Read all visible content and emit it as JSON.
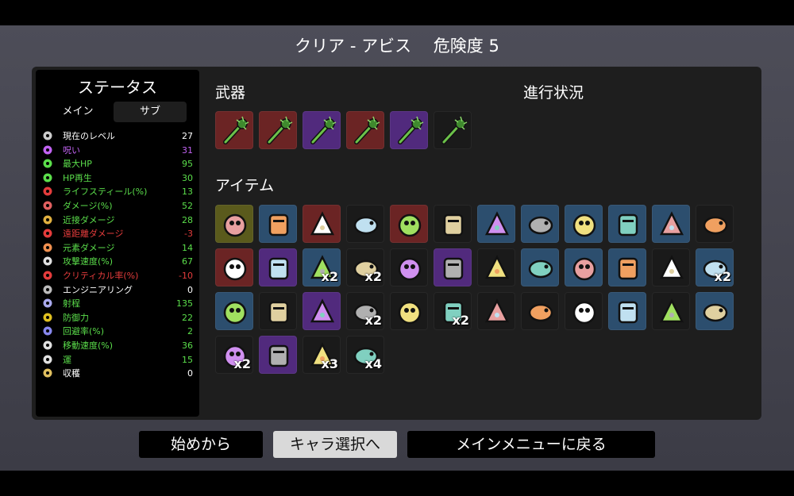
{
  "header": {
    "title": "クリア - アビス　 危険度 5"
  },
  "colors": {
    "white": "#ffffff",
    "purple": "#c163f2",
    "green": "#5bde4b",
    "red": "#e43c3c",
    "slot_red": "#6b2424",
    "slot_purple": "#512a7d",
    "slot_blue": "#2c4e6e",
    "slot_gray": "#1a1a1a",
    "slot_olive": "#5a5a1c"
  },
  "stats": {
    "title": "ステータス",
    "tabs": [
      "メイン",
      "サブ"
    ],
    "rows": [
      {
        "icon": "level-icon",
        "label": "現在のレベル",
        "value": "27",
        "color": "#ffffff"
      },
      {
        "icon": "curse-icon",
        "label": "呪い",
        "value": "31",
        "color": "#c163f2"
      },
      {
        "icon": "heart-icon",
        "label": "最大HP",
        "value": "95",
        "color": "#5bde4b"
      },
      {
        "icon": "hp-regen-icon",
        "label": "HP再生",
        "value": "30",
        "color": "#5bde4b"
      },
      {
        "icon": "lifesteal-icon",
        "label": "ライフスティール(%)",
        "value": "13",
        "color": "#5bde4b"
      },
      {
        "icon": "damage-icon",
        "label": "ダメージ(%)",
        "value": "52",
        "color": "#5bde4b"
      },
      {
        "icon": "melee-icon",
        "label": "近接ダメージ",
        "value": "28",
        "color": "#5bde4b"
      },
      {
        "icon": "ranged-icon",
        "label": "遠距離ダメージ",
        "value": "-3",
        "color": "#e43c3c"
      },
      {
        "icon": "elemental-icon",
        "label": "元素ダメージ",
        "value": "14",
        "color": "#5bde4b"
      },
      {
        "icon": "attack-speed-icon",
        "label": "攻撃速度(%)",
        "value": "67",
        "color": "#5bde4b"
      },
      {
        "icon": "crit-icon",
        "label": "クリティカル率(%)",
        "value": "-10",
        "color": "#e43c3c"
      },
      {
        "icon": "engineering-icon",
        "label": "エンジニアリング",
        "value": "0",
        "color": "#ffffff"
      },
      {
        "icon": "range-icon",
        "label": "射程",
        "value": "135",
        "color": "#5bde4b"
      },
      {
        "icon": "armor-icon",
        "label": "防御力",
        "value": "22",
        "color": "#5bde4b"
      },
      {
        "icon": "dodge-icon",
        "label": "回避率(%)",
        "value": "2",
        "color": "#5bde4b"
      },
      {
        "icon": "speed-icon",
        "label": "移動速度(%)",
        "value": "36",
        "color": "#5bde4b"
      },
      {
        "icon": "luck-icon",
        "label": "運",
        "value": "15",
        "color": "#5bde4b"
      },
      {
        "icon": "harvest-icon",
        "label": "収穫",
        "value": "0",
        "color": "#ffffff"
      }
    ]
  },
  "weapons": {
    "title": "武器",
    "slots": [
      {
        "icon": "thorn-club-icon",
        "tier": "red"
      },
      {
        "icon": "thorn-club-icon",
        "tier": "red"
      },
      {
        "icon": "thorn-club-icon",
        "tier": "purple"
      },
      {
        "icon": "thorn-club-icon",
        "tier": "red"
      },
      {
        "icon": "thorn-club-icon",
        "tier": "purple"
      },
      {
        "icon": "thorn-club-icon",
        "tier": "gray"
      }
    ]
  },
  "progress": {
    "title": "進行状況"
  },
  "items": {
    "title": "アイテム",
    "rows": [
      [
        {
          "icon": "ninja-mask-icon",
          "tier": "olive",
          "qty": ""
        },
        {
          "icon": "scroll-icon",
          "tier": "blue",
          "qty": ""
        },
        {
          "icon": "panda-icon",
          "tier": "red",
          "qty": ""
        },
        {
          "icon": "lemonade-icon",
          "tier": "gray",
          "qty": ""
        },
        {
          "icon": "octopus-icon",
          "tier": "red",
          "qty": ""
        },
        {
          "icon": "shark-tooth-icon",
          "tier": "gray",
          "qty": ""
        },
        {
          "icon": "crab-claws-icon",
          "tier": "blue",
          "qty": ""
        },
        {
          "icon": "pirate-bandana-icon",
          "tier": "blue",
          "qty": ""
        },
        {
          "icon": "black-belt-icon",
          "tier": "blue",
          "qty": ""
        },
        {
          "icon": "garden-icon",
          "tier": "blue",
          "qty": ""
        },
        {
          "icon": "crystal-ball-icon",
          "tier": "blue",
          "qty": ""
        },
        {
          "icon": "penguin-icon",
          "tier": "gray",
          "qty": ""
        }
      ],
      [
        {
          "icon": "stomach-icon",
          "tier": "red",
          "qty": ""
        },
        {
          "icon": "pumpkin-icon",
          "tier": "purple",
          "qty": ""
        },
        {
          "icon": "spyglass-icon",
          "tier": "blue",
          "qty": "x2"
        },
        {
          "icon": "demon-mask-icon",
          "tier": "gray",
          "qty": "x2"
        },
        {
          "icon": "blade-icon",
          "tier": "gray",
          "qty": ""
        },
        {
          "icon": "alien-head-icon",
          "tier": "purple",
          "qty": ""
        },
        {
          "icon": "rocket-icon",
          "tier": "gray",
          "qty": ""
        },
        {
          "icon": "anchor-chain-icon",
          "tier": "blue",
          "qty": ""
        },
        {
          "icon": "snail-icon",
          "tier": "blue",
          "qty": ""
        },
        {
          "icon": "log-icon",
          "tier": "blue",
          "qty": ""
        },
        {
          "icon": "cake-icon",
          "tier": "gray",
          "qty": ""
        },
        {
          "icon": "cherry-bomb-icon",
          "tier": "blue",
          "qty": "x2"
        }
      ],
      [
        {
          "icon": "medkit-robot-icon",
          "tier": "blue",
          "qty": ""
        },
        {
          "icon": "syringe-icon",
          "tier": "gray",
          "qty": ""
        },
        {
          "icon": "flag-icon",
          "tier": "purple",
          "qty": ""
        },
        {
          "icon": "claw-icon",
          "tier": "gray",
          "qty": "x2"
        },
        {
          "icon": "lizard-icon",
          "tier": "gray",
          "qty": ""
        },
        {
          "icon": "bubbles-icon",
          "tier": "gray",
          "qty": "x2"
        },
        {
          "icon": "mushroom-icon",
          "tier": "gray",
          "qty": ""
        },
        {
          "icon": "coffee-icon",
          "tier": "gray",
          "qty": ""
        },
        {
          "icon": "skull-mask-icon",
          "tier": "gray",
          "qty": ""
        },
        {
          "icon": "coffin-icon",
          "tier": "blue",
          "qty": ""
        },
        {
          "icon": "snake-icon",
          "tier": "gray",
          "qty": ""
        },
        {
          "icon": "small-octopus-icon",
          "tier": "blue",
          "qty": ""
        }
      ],
      [
        {
          "icon": "scythe-icon",
          "tier": "gray",
          "qty": "x2"
        },
        {
          "icon": "rat-icon",
          "tier": "purple",
          "qty": ""
        },
        {
          "icon": "rock-icon",
          "tier": "gray",
          "qty": "x3"
        },
        {
          "icon": "tentacle-icon",
          "tier": "gray",
          "qty": "x4"
        }
      ]
    ]
  },
  "buttons": {
    "restart": "始めから",
    "character_select": "キャラ選択へ",
    "main_menu": "メインメニューに戻る"
  }
}
